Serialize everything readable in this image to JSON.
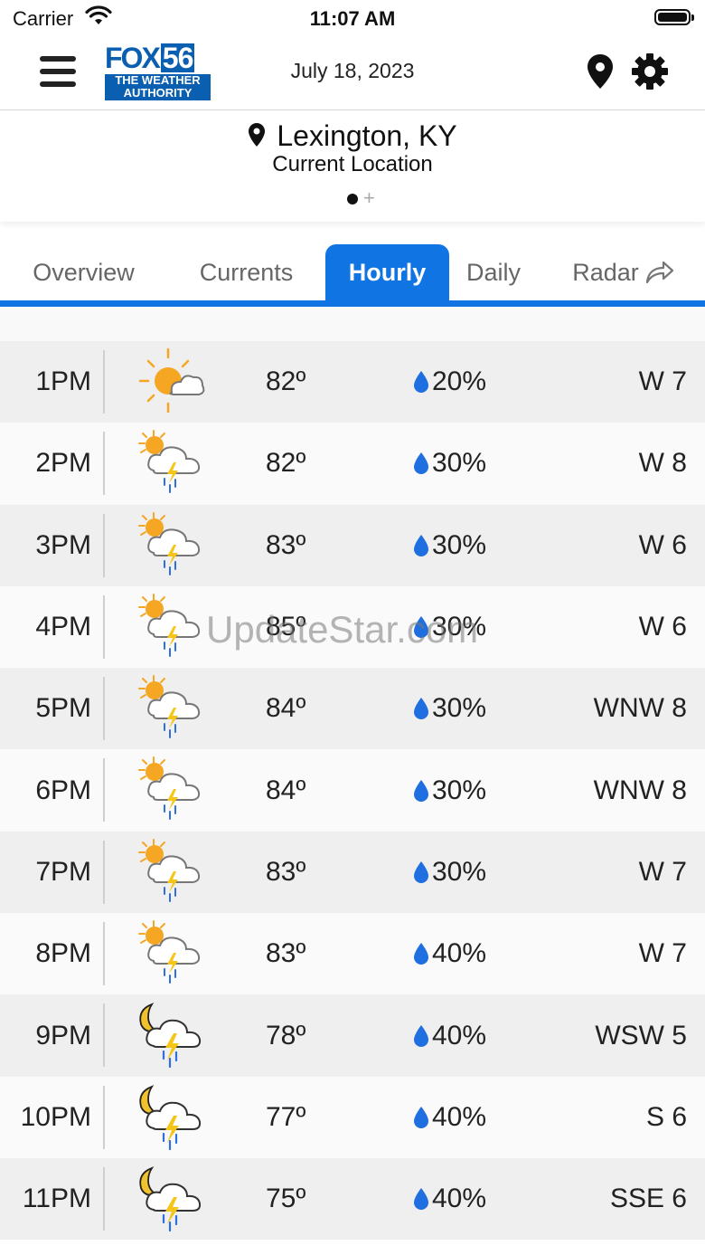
{
  "status_bar": {
    "carrier": "Carrier",
    "time": "11:07 AM"
  },
  "header": {
    "logo_top": "FOX",
    "logo_number": "56",
    "logo_line1": "THE WEATHER",
    "logo_line2": "AUTHORITY",
    "date": "July 18, 2023"
  },
  "location": {
    "name": "Lexington, KY",
    "subtitle": "Current Location",
    "page_dots": 1,
    "add_symbol": "+"
  },
  "tabs": [
    {
      "label": "Overview",
      "active": false
    },
    {
      "label": "Currents",
      "active": false
    },
    {
      "label": "Hourly",
      "active": true
    },
    {
      "label": "Daily",
      "active": false
    },
    {
      "label": "Radar",
      "active": false
    }
  ],
  "hourly": [
    {
      "hour": "1PM",
      "icon": "partly-sunny-icon",
      "temp": "82º",
      "precip": "20%",
      "wind": "W 7"
    },
    {
      "hour": "2PM",
      "icon": "sun-thunderstorm-icon",
      "temp": "82º",
      "precip": "30%",
      "wind": "W 8"
    },
    {
      "hour": "3PM",
      "icon": "sun-thunderstorm-icon",
      "temp": "83º",
      "precip": "30%",
      "wind": "W 6"
    },
    {
      "hour": "4PM",
      "icon": "sun-thunderstorm-icon",
      "temp": "85º",
      "precip": "30%",
      "wind": "W 6"
    },
    {
      "hour": "5PM",
      "icon": "sun-thunderstorm-icon",
      "temp": "84º",
      "precip": "30%",
      "wind": "WNW 8"
    },
    {
      "hour": "6PM",
      "icon": "sun-thunderstorm-icon",
      "temp": "84º",
      "precip": "30%",
      "wind": "WNW 8"
    },
    {
      "hour": "7PM",
      "icon": "sun-thunderstorm-icon",
      "temp": "83º",
      "precip": "30%",
      "wind": "W 7"
    },
    {
      "hour": "8PM",
      "icon": "sun-thunderstorm-icon",
      "temp": "83º",
      "precip": "40%",
      "wind": "W 7"
    },
    {
      "hour": "9PM",
      "icon": "moon-thunderstorm-icon",
      "temp": "78º",
      "precip": "40%",
      "wind": "WSW 5"
    },
    {
      "hour": "10PM",
      "icon": "moon-thunderstorm-icon",
      "temp": "77º",
      "precip": "40%",
      "wind": "S 6"
    },
    {
      "hour": "11PM",
      "icon": "moon-thunderstorm-icon",
      "temp": "75º",
      "precip": "40%",
      "wind": "SSE 6"
    }
  ],
  "watermark": "UpdateStar.com",
  "colors": {
    "accent": "#1074e3",
    "logo_blue": "#0b5fb0",
    "sun": "#f5a623",
    "moon": "#f2c12e",
    "bolt": "#f5c518",
    "rain": "#2f6fe0"
  }
}
